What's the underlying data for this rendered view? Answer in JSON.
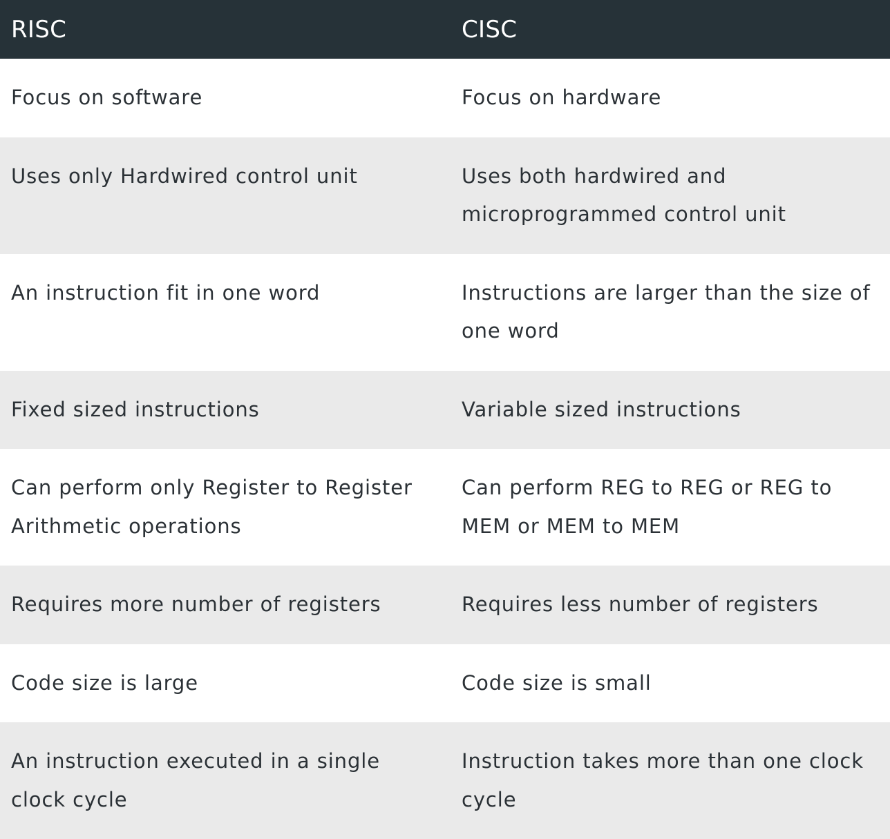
{
  "table": {
    "headers": [
      "RISC",
      "CISC"
    ],
    "rows": [
      [
        "Focus on software",
        "Focus on hardware"
      ],
      [
        "Uses only Hardwired control unit",
        "Uses both hardwired and microprogrammed control unit"
      ],
      [
        "An instruction fit in one word",
        "Instructions are larger than the size of one word"
      ],
      [
        "Fixed sized instructions",
        "Variable sized instructions"
      ],
      [
        "Can perform only Register to Register Arithmetic operations",
        "Can perform REG to REG or REG to MEM or MEM to MEM"
      ],
      [
        "Requires more number of registers",
        "Requires less number of registers"
      ],
      [
        "Code size is large",
        "Code size is small"
      ],
      [
        "An instruction executed in a single clock cycle",
        "Instruction takes more than one clock cycle"
      ]
    ]
  },
  "colors": {
    "header_bg": "#263238",
    "header_text": "#ffffff",
    "row_alt_bg": "#eaeaea",
    "row_bg": "#ffffff",
    "body_text": "#2b3136"
  }
}
